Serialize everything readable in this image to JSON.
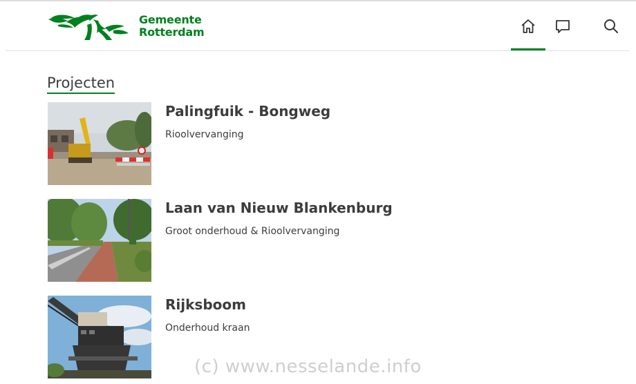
{
  "header": {
    "logo_line1": "Gemeente",
    "logo_line2": "Rotterdam",
    "nav": [
      {
        "icon": "home-icon",
        "active": true
      },
      {
        "icon": "chat-icon",
        "active": false
      },
      {
        "icon": "search-icon",
        "active": false
      }
    ]
  },
  "main": {
    "section_title": "Projecten",
    "projects": [
      {
        "title": "Palingfuik - Bongweg",
        "subtitle": "Rioolvervanging",
        "image": "construction-site-photo"
      },
      {
        "title": "Laan van Nieuw Blankenburg",
        "subtitle": "Groot onderhoud & Rioolvervanging",
        "image": "tree-lined-road-photo"
      },
      {
        "title": "Rijksboom",
        "subtitle": "Onderhoud kraan",
        "image": "harbour-crane-photo"
      }
    ]
  },
  "watermark": "(c)  www.nesselande.info",
  "colors": {
    "brand_green": "#00811f",
    "text": "#3c3c3c"
  }
}
